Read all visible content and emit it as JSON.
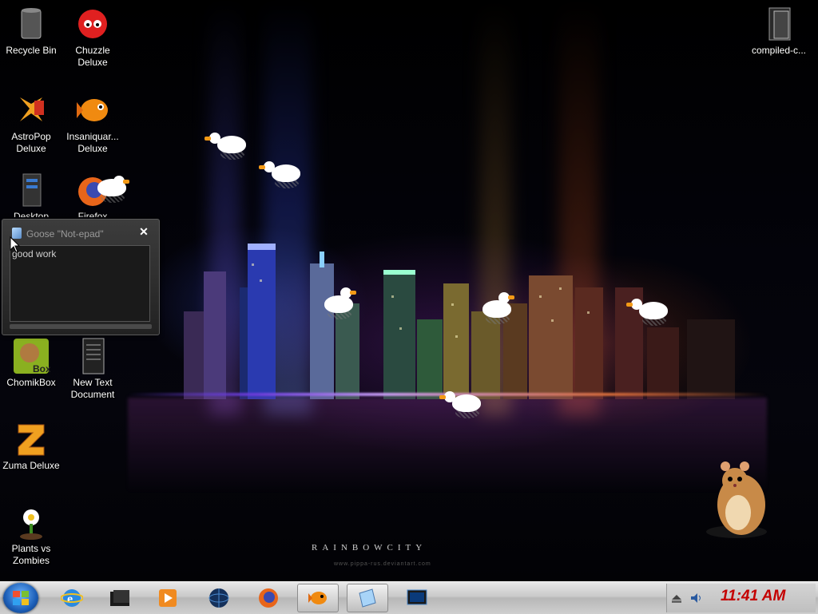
{
  "desktop": {
    "icons": [
      {
        "label": "Recycle Bin"
      },
      {
        "label": "Chuzzle Deluxe"
      },
      {
        "label": "AstroPop Deluxe"
      },
      {
        "label": "Insaniquar... Deluxe"
      },
      {
        "label": "Desktop"
      },
      {
        "label": "Firefox"
      },
      {
        "label": "ChomikBox"
      },
      {
        "label": "New Text Document"
      },
      {
        "label": "Zuma Deluxe"
      },
      {
        "label": "Plants vs Zombies"
      },
      {
        "label": "compiled-c..."
      }
    ],
    "wallpaper_title": "RAINBOWCITY",
    "wallpaper_subtitle": "www.pippa-rus.deviantart.com"
  },
  "notepad": {
    "title": "Goose \"Not-epad\"",
    "close_label": "✕",
    "text": "good work"
  },
  "taskbar": {
    "start_label": "Start",
    "buttons": [
      {
        "name": "Internet Explorer",
        "icon": "ie-icon"
      },
      {
        "name": "Desktop",
        "icon": "desktop-icon"
      },
      {
        "name": "Media Player",
        "icon": "media-player-icon"
      },
      {
        "name": "Network",
        "icon": "globe-icon"
      },
      {
        "name": "Firefox",
        "icon": "firefox-icon"
      },
      {
        "name": "Insaniquarium",
        "icon": "fish-icon"
      },
      {
        "name": "Goose Not-epad",
        "icon": "notepad-icon"
      },
      {
        "name": "Screen",
        "icon": "monitor-icon"
      }
    ],
    "clock": "11:41 AM"
  },
  "colors": {
    "clock": "#c40000",
    "taskbar": "#c9c9c9",
    "goose_beak": "#f39a16"
  }
}
